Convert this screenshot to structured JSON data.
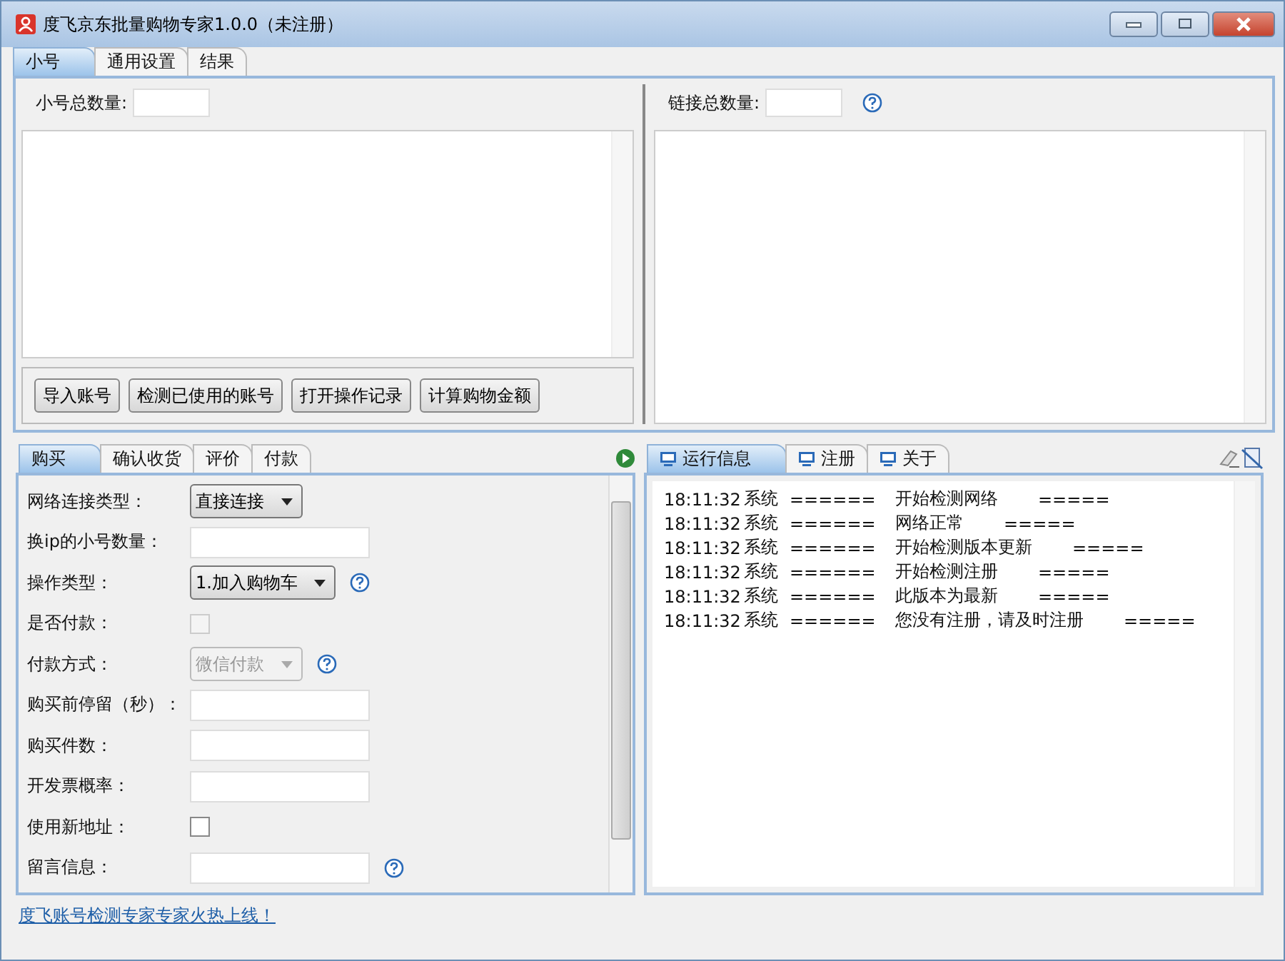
{
  "window": {
    "title": "度飞京东批量购物专家1.0.0（未注册）"
  },
  "main_tabs": [
    {
      "label": "小号",
      "selected": true
    },
    {
      "label": "通用设置",
      "selected": false
    },
    {
      "label": "结果",
      "selected": false
    }
  ],
  "accounts": {
    "count_label": "小号总数量:",
    "buttons": [
      "导入账号",
      "检测已使用的账号",
      "打开操作记录",
      "计算购物金额"
    ]
  },
  "links": {
    "count_label": "链接总数量:"
  },
  "order_tabs": [
    {
      "label": "购买",
      "selected": true
    },
    {
      "label": "确认收货",
      "selected": false
    },
    {
      "label": "评价",
      "selected": false
    },
    {
      "label": "付款",
      "selected": false
    }
  ],
  "form": [
    {
      "label": "网络连接类型：",
      "kind": "select",
      "value": "直接连接",
      "disabled": false,
      "help": false
    },
    {
      "label": "换ip的小号数量：",
      "kind": "input",
      "help": false
    },
    {
      "label": "操作类型：",
      "kind": "select",
      "value": "1.加入购物车",
      "disabled": false,
      "help": true
    },
    {
      "label": "是否付款：",
      "kind": "checkbox",
      "checked": false,
      "disabled": true,
      "help": false
    },
    {
      "label": "付款方式：",
      "kind": "select",
      "value": "微信付款",
      "disabled": true,
      "help": true
    },
    {
      "label": "购买前停留（秒）：",
      "kind": "input",
      "help": false
    },
    {
      "label": "购买件数：",
      "kind": "input",
      "help": false
    },
    {
      "label": "开发票概率：",
      "kind": "input",
      "help": false
    },
    {
      "label": "使用新地址：",
      "kind": "checkbox",
      "checked": false,
      "disabled": false,
      "help": false
    },
    {
      "label": "留言信息：",
      "kind": "input",
      "help": true
    }
  ],
  "log_tabs": [
    {
      "label": "运行信息",
      "selected": true
    },
    {
      "label": "注册",
      "selected": false
    },
    {
      "label": "关于",
      "selected": false
    }
  ],
  "log": [
    {
      "time": "18:11:32",
      "source": "系统",
      "marker": "======",
      "message": "开始检测网络",
      "end": "====="
    },
    {
      "time": "18:11:32",
      "source": "系统",
      "marker": "======",
      "message": "网络正常",
      "end": "====="
    },
    {
      "time": "18:11:32",
      "source": "系统",
      "marker": "======",
      "message": "开始检测版本更新",
      "end": "====="
    },
    {
      "time": "18:11:32",
      "source": "系统",
      "marker": "======",
      "message": "开始检测注册",
      "end": "====="
    },
    {
      "time": "18:11:32",
      "source": "系统",
      "marker": "======",
      "message": "此版本为最新",
      "end": "====="
    },
    {
      "time": "18:11:32",
      "source": "系统",
      "marker": "======",
      "message": "您没有注册，请及时注册",
      "end": "====="
    }
  ],
  "footer_link": "度飞账号检测专家专家火热上线！"
}
